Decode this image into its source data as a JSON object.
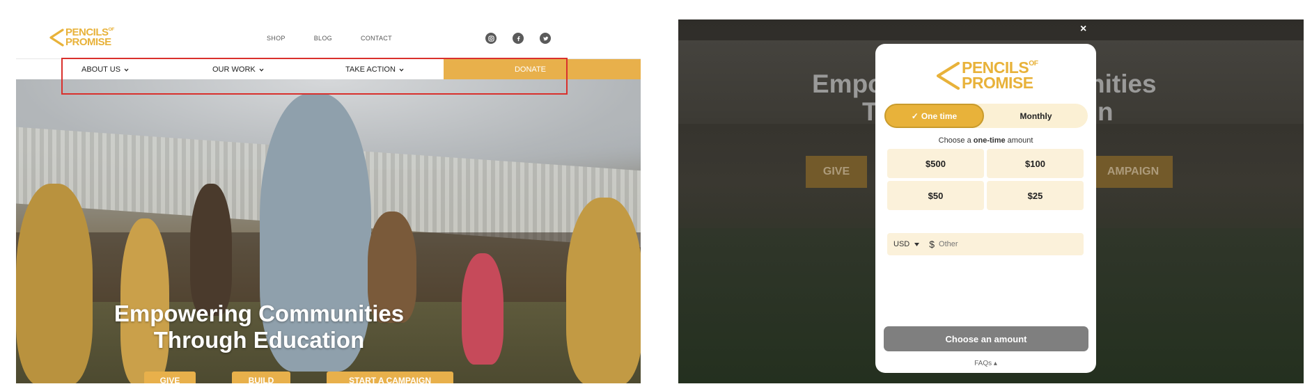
{
  "site": {
    "logo_line1": "PENCILS",
    "logo_of": "OF",
    "logo_line2": "PROMISE",
    "top_links": [
      "SHOP",
      "BLOG",
      "CONTACT"
    ],
    "socials": [
      "instagram-icon",
      "facebook-icon",
      "twitter-icon"
    ],
    "nav": [
      {
        "label": "ABOUT US"
      },
      {
        "label": "OUR WORK"
      },
      {
        "label": "TAKE ACTION"
      }
    ],
    "donate_label": "DONATE",
    "hero_title_line1": "Empowering Communities",
    "hero_title_line2": "Through Education",
    "hero_buttons": [
      "GIVE",
      "BUILD",
      "START A CAMPAIGN"
    ],
    "colors": {
      "brand": "#e8b23a",
      "highlight": "#d9302c"
    }
  },
  "modal": {
    "close_label": "×",
    "bg_title_left": "Empo",
    "bg_title_right": "nities",
    "bg_title_row2_left": "T",
    "bg_title_row2_right": "n",
    "bg_btn_left": "GIVE",
    "bg_btn_right": "AMPAIGN",
    "frequency": {
      "one_time": "One time",
      "monthly": "Monthly",
      "selected": "One time"
    },
    "choose_prefix": "Choose a ",
    "choose_bold": "one-time",
    "choose_suffix": " amount",
    "amounts": [
      "$500",
      "$100",
      "$50",
      "$25"
    ],
    "currency": "USD",
    "currency_symbol": "$",
    "other_placeholder": "Other",
    "cta_label": "Choose an amount",
    "faqs_label": "FAQs ▴"
  }
}
